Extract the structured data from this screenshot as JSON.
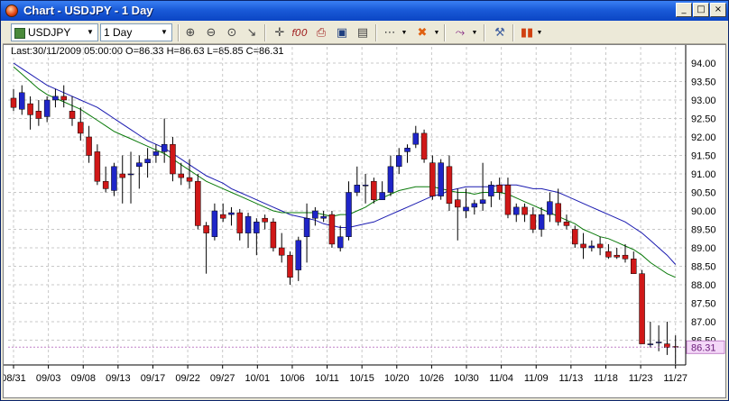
{
  "window": {
    "title": "Chart - USDJPY - 1 Day"
  },
  "toolbar": {
    "symbol": "USDJPY",
    "timeframe": "1 Day",
    "icons": [
      "zoom-in-icon",
      "zoom-out-icon",
      "zoom-reset-icon",
      "draw-line-icon",
      "crosshair-icon",
      "price-icon",
      "print-icon",
      "save-icon",
      "document-icon",
      "grid-icon",
      "objects-icon",
      "indicator-icon",
      "properties-icon",
      "chart-type-icon"
    ]
  },
  "info_line": "Last:30/11/2009 05:00:00 O=86.33 H=86.63 L=85.85 C=86.31",
  "colors": {
    "up": "#1f25c8",
    "down": "#d01818",
    "ma_fast": "#0a7a0a",
    "ma_slow": "#1a1ab0",
    "last_label_bg": "#f4d8f8",
    "last_label_fg": "#6a1a7a"
  },
  "chart_data": {
    "type": "candlestick",
    "symbol": "USDJPY",
    "timeframe": "1 Day",
    "ylim": [
      86.0,
      94.0
    ],
    "y_ticks": [
      "94.00",
      "93.50",
      "93.00",
      "92.50",
      "92.00",
      "91.50",
      "91.00",
      "90.50",
      "90.00",
      "89.50",
      "89.00",
      "88.50",
      "88.00",
      "87.50",
      "87.00",
      "86.50"
    ],
    "x_labels": [
      "08/31",
      "09/03",
      "09/08",
      "09/13",
      "09/17",
      "09/22",
      "09/27",
      "10/01",
      "10/06",
      "10/11",
      "10/15",
      "10/20",
      "10/26",
      "10/30",
      "11/04",
      "11/09",
      "11/13",
      "11/18",
      "11/23",
      "11/27"
    ],
    "last_price": "86.31",
    "grid": true,
    "candles": [
      [
        93.05,
        93.3,
        92.7,
        92.8
      ],
      [
        92.75,
        93.4,
        92.6,
        93.2
      ],
      [
        92.9,
        93.1,
        92.2,
        92.6
      ],
      [
        92.7,
        93.0,
        92.3,
        92.5
      ],
      [
        92.55,
        93.1,
        92.4,
        93.0
      ],
      [
        93.0,
        93.3,
        92.8,
        93.1
      ],
      [
        93.1,
        93.4,
        92.8,
        93.0
      ],
      [
        92.7,
        93.1,
        92.3,
        92.5
      ],
      [
        92.4,
        92.8,
        91.9,
        92.1
      ],
      [
        92.0,
        92.3,
        91.3,
        91.5
      ],
      [
        91.6,
        91.8,
        90.7,
        90.8
      ],
      [
        90.8,
        91.2,
        90.5,
        90.6
      ],
      [
        90.55,
        91.3,
        90.4,
        91.2
      ],
      [
        91.0,
        91.5,
        90.2,
        90.9
      ],
      [
        91.0,
        91.6,
        90.2,
        91.0
      ],
      [
        91.2,
        91.5,
        90.6,
        91.3
      ],
      [
        91.3,
        91.7,
        90.9,
        91.4
      ],
      [
        91.5,
        91.8,
        91.3,
        91.6
      ],
      [
        91.6,
        92.5,
        91.3,
        91.8
      ],
      [
        91.8,
        92.0,
        90.8,
        91.0
      ],
      [
        91.0,
        91.3,
        90.7,
        90.9
      ],
      [
        90.9,
        91.4,
        90.6,
        90.8
      ],
      [
        90.8,
        91.0,
        89.5,
        89.6
      ],
      [
        89.6,
        89.7,
        88.3,
        89.4
      ],
      [
        89.3,
        90.2,
        89.2,
        90.0
      ],
      [
        89.9,
        90.2,
        89.7,
        89.8
      ],
      [
        89.9,
        90.1,
        89.6,
        89.95
      ],
      [
        89.95,
        90.05,
        89.2,
        89.4
      ],
      [
        89.4,
        89.95,
        89.0,
        89.85
      ],
      [
        89.4,
        89.8,
        88.8,
        89.7
      ],
      [
        89.8,
        89.9,
        89.5,
        89.7
      ],
      [
        89.7,
        89.8,
        88.9,
        89.0
      ],
      [
        89.0,
        89.4,
        88.6,
        88.8
      ],
      [
        88.8,
        88.9,
        88.0,
        88.2
      ],
      [
        88.4,
        89.3,
        88.1,
        89.2
      ],
      [
        89.3,
        90.2,
        88.6,
        89.8
      ],
      [
        89.8,
        90.1,
        89.6,
        90.0
      ],
      [
        89.8,
        90.0,
        89.7,
        89.85
      ],
      [
        89.9,
        90.0,
        89.0,
        89.1
      ],
      [
        89.0,
        89.6,
        88.9,
        89.3
      ],
      [
        89.3,
        90.8,
        89.2,
        90.5
      ],
      [
        90.5,
        91.2,
        90.4,
        90.7
      ],
      [
        90.7,
        91.0,
        90.2,
        90.7
      ],
      [
        90.8,
        90.9,
        90.2,
        90.3
      ],
      [
        90.3,
        90.8,
        90.3,
        90.5
      ],
      [
        90.5,
        91.5,
        90.4,
        91.2
      ],
      [
        91.2,
        91.7,
        91.0,
        91.5
      ],
      [
        91.6,
        91.8,
        91.3,
        91.7
      ],
      [
        91.8,
        92.3,
        91.7,
        92.1
      ],
      [
        92.1,
        92.2,
        91.3,
        91.4
      ],
      [
        91.3,
        91.5,
        90.3,
        90.4
      ],
      [
        90.4,
        91.4,
        90.3,
        91.3
      ],
      [
        91.2,
        91.5,
        90.0,
        90.2
      ],
      [
        90.3,
        90.6,
        89.2,
        90.1
      ],
      [
        90.0,
        90.6,
        89.8,
        90.1
      ],
      [
        90.1,
        90.3,
        89.9,
        90.2
      ],
      [
        90.2,
        91.3,
        90.0,
        90.3
      ],
      [
        90.4,
        90.8,
        90.1,
        90.7
      ],
      [
        90.7,
        90.9,
        90.3,
        90.5
      ],
      [
        90.7,
        90.9,
        89.8,
        89.9
      ],
      [
        89.9,
        90.2,
        89.7,
        90.1
      ],
      [
        90.1,
        90.2,
        89.7,
        89.9
      ],
      [
        89.9,
        90.1,
        89.4,
        89.5
      ],
      [
        89.5,
        90.1,
        89.3,
        89.9
      ],
      [
        89.9,
        90.5,
        89.7,
        90.25
      ],
      [
        90.2,
        90.6,
        89.6,
        89.7
      ],
      [
        89.7,
        89.9,
        89.5,
        89.6
      ],
      [
        89.5,
        89.6,
        89.0,
        89.1
      ],
      [
        89.1,
        89.4,
        88.7,
        89.0
      ],
      [
        89.0,
        89.2,
        88.9,
        89.05
      ],
      [
        89.1,
        89.3,
        88.8,
        89.0
      ],
      [
        88.9,
        89.1,
        88.7,
        88.75
      ],
      [
        88.8,
        89.0,
        88.7,
        88.75
      ],
      [
        88.8,
        89.1,
        88.6,
        88.7
      ],
      [
        88.7,
        88.9,
        88.3,
        88.3
      ],
      [
        88.3,
        88.4,
        86.4,
        86.4
      ],
      [
        86.4,
        87.0,
        86.3,
        86.4
      ],
      [
        86.45,
        86.9,
        86.2,
        86.45
      ],
      [
        86.4,
        87.0,
        86.1,
        86.3
      ],
      [
        86.33,
        86.63,
        85.85,
        86.31
      ]
    ],
    "ma_fast": [
      93.9,
      93.7,
      93.5,
      93.3,
      93.15,
      93.05,
      92.95,
      92.85,
      92.75,
      92.6,
      92.45,
      92.3,
      92.15,
      92.05,
      91.95,
      91.85,
      91.75,
      91.65,
      91.55,
      91.4,
      91.25,
      91.1,
      90.95,
      90.8,
      90.7,
      90.6,
      90.5,
      90.4,
      90.3,
      90.2,
      90.1,
      90.0,
      89.95,
      89.95,
      89.95,
      89.95,
      89.95,
      89.9,
      89.85,
      89.9,
      89.9,
      90.0,
      90.1,
      90.25,
      90.35,
      90.45,
      90.55,
      90.6,
      90.65,
      90.65,
      90.65,
      90.6,
      90.55,
      90.5,
      90.5,
      90.45,
      90.5,
      90.5,
      90.5,
      90.45,
      90.35,
      90.25,
      90.15,
      90.05,
      89.95,
      89.85,
      89.75,
      89.65,
      89.5,
      89.4,
      89.3,
      89.25,
      89.15,
      89.05,
      88.95,
      88.8,
      88.6,
      88.45,
      88.3,
      88.2
    ],
    "ma_slow": [
      94.0,
      93.85,
      93.7,
      93.55,
      93.4,
      93.3,
      93.2,
      93.1,
      93.0,
      92.9,
      92.8,
      92.65,
      92.5,
      92.35,
      92.2,
      92.05,
      91.9,
      91.8,
      91.7,
      91.55,
      91.4,
      91.25,
      91.1,
      90.95,
      90.85,
      90.75,
      90.6,
      90.5,
      90.4,
      90.3,
      90.2,
      90.1,
      90.0,
      89.9,
      89.85,
      89.8,
      89.75,
      89.65,
      89.6,
      89.55,
      89.55,
      89.6,
      89.65,
      89.7,
      89.8,
      89.9,
      90.0,
      90.1,
      90.2,
      90.3,
      90.4,
      90.45,
      90.55,
      90.6,
      90.65,
      90.65,
      90.65,
      90.65,
      90.7,
      90.7,
      90.7,
      90.65,
      90.6,
      90.6,
      90.55,
      90.5,
      90.4,
      90.3,
      90.2,
      90.1,
      90.0,
      89.9,
      89.8,
      89.7,
      89.55,
      89.4,
      89.2,
      89.0,
      88.8,
      88.55
    ]
  }
}
